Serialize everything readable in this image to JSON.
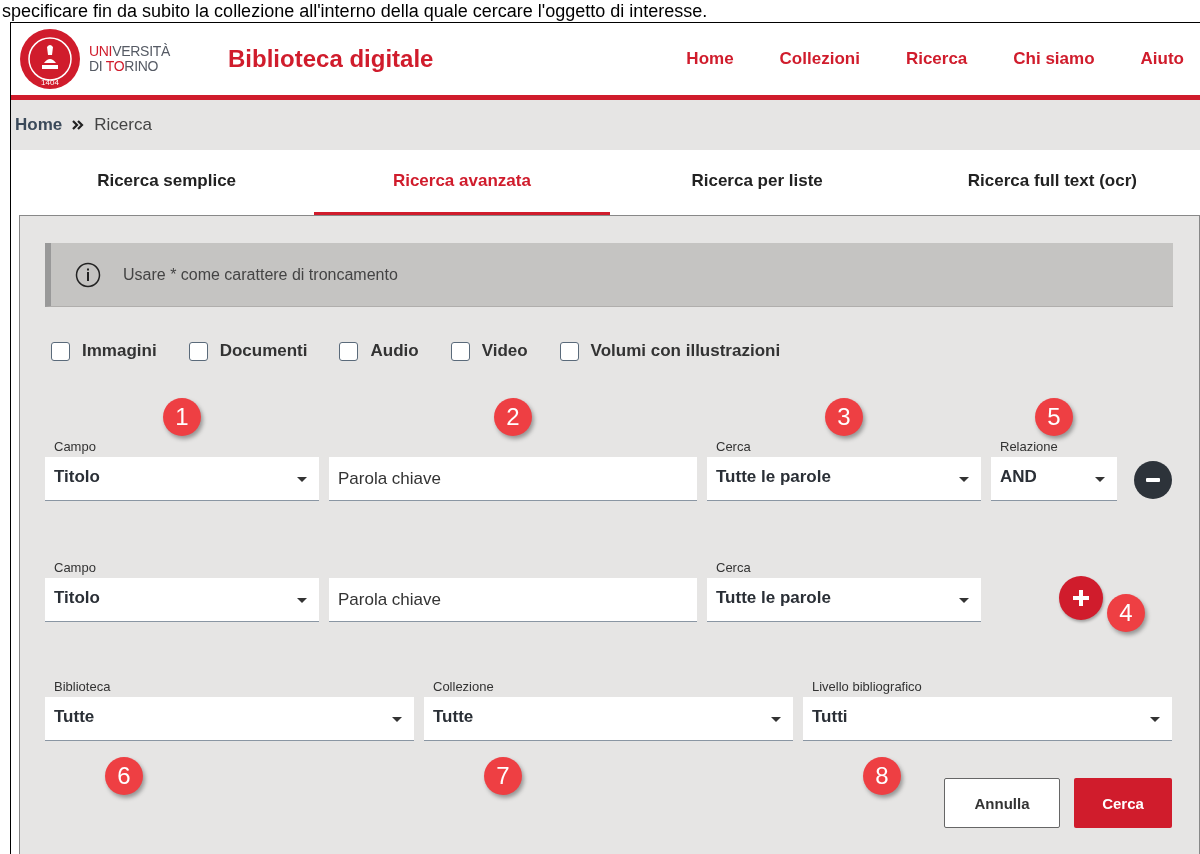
{
  "caption": "specificare fin da subito la collezione all'interno della quale cercare l'oggetto di interesse.",
  "header": {
    "wordmark": [
      [
        {
          "text": "UNI",
          "accent": true
        },
        {
          "text": "VERSITÀ",
          "accent": false
        }
      ],
      [
        {
          "text": "DI ",
          "accent": false
        },
        {
          "text": "TO",
          "accent": true
        },
        {
          "text": "RINO",
          "accent": false
        }
      ]
    ],
    "seal_year": "1404",
    "site_title": "Biblioteca digitale",
    "nav": [
      "Home",
      "Collezioni",
      "Ricerca",
      "Chi siamo",
      "Aiuto"
    ]
  },
  "breadcrumb": [
    "Home",
    "Ricerca"
  ],
  "tabs": [
    {
      "label": "Ricerca semplice",
      "selected": false
    },
    {
      "label": "Ricerca avanzata",
      "selected": true
    },
    {
      "label": "Ricerca per liste",
      "selected": false
    },
    {
      "label": "Ricerca full text (ocr)",
      "selected": false
    }
  ],
  "info": "Usare * come carattere di troncamento",
  "filters": [
    {
      "label": "Immagini",
      "checked": false
    },
    {
      "label": "Documenti",
      "checked": false
    },
    {
      "label": "Audio",
      "checked": false
    },
    {
      "label": "Video",
      "checked": false
    },
    {
      "label": "Volumi con illustrazioni",
      "checked": false
    }
  ],
  "rows": [
    {
      "fields": [
        {
          "kind": "select",
          "label": "Campo",
          "value": "Titolo",
          "marker": "1"
        },
        {
          "kind": "text",
          "placeholder": "Parola chiave",
          "marker": "2"
        },
        {
          "kind": "select",
          "label": "Cerca",
          "value": "Tutte le parole",
          "marker": "3"
        },
        {
          "kind": "select",
          "label": "Relazione",
          "value": "AND",
          "marker": "5"
        }
      ],
      "action": {
        "kind": "remove"
      }
    },
    {
      "fields": [
        {
          "kind": "select",
          "label": "Campo",
          "value": "Titolo"
        },
        {
          "kind": "text",
          "placeholder": "Parola chiave"
        },
        {
          "kind": "select",
          "label": "Cerca",
          "value": "Tutte le parole"
        }
      ],
      "action": {
        "kind": "add",
        "marker": "4"
      }
    }
  ],
  "bottom_fields": [
    {
      "label": "Biblioteca",
      "value": "Tutte",
      "marker": "6"
    },
    {
      "label": "Collezione",
      "value": "Tutte",
      "marker": "7"
    },
    {
      "label": "Livello bibliografico",
      "value": "Tutti",
      "marker": "8"
    }
  ],
  "buttons": [
    {
      "label": "Annulla",
      "kind": "secondary"
    },
    {
      "label": "Cerca",
      "kind": "primary"
    }
  ]
}
